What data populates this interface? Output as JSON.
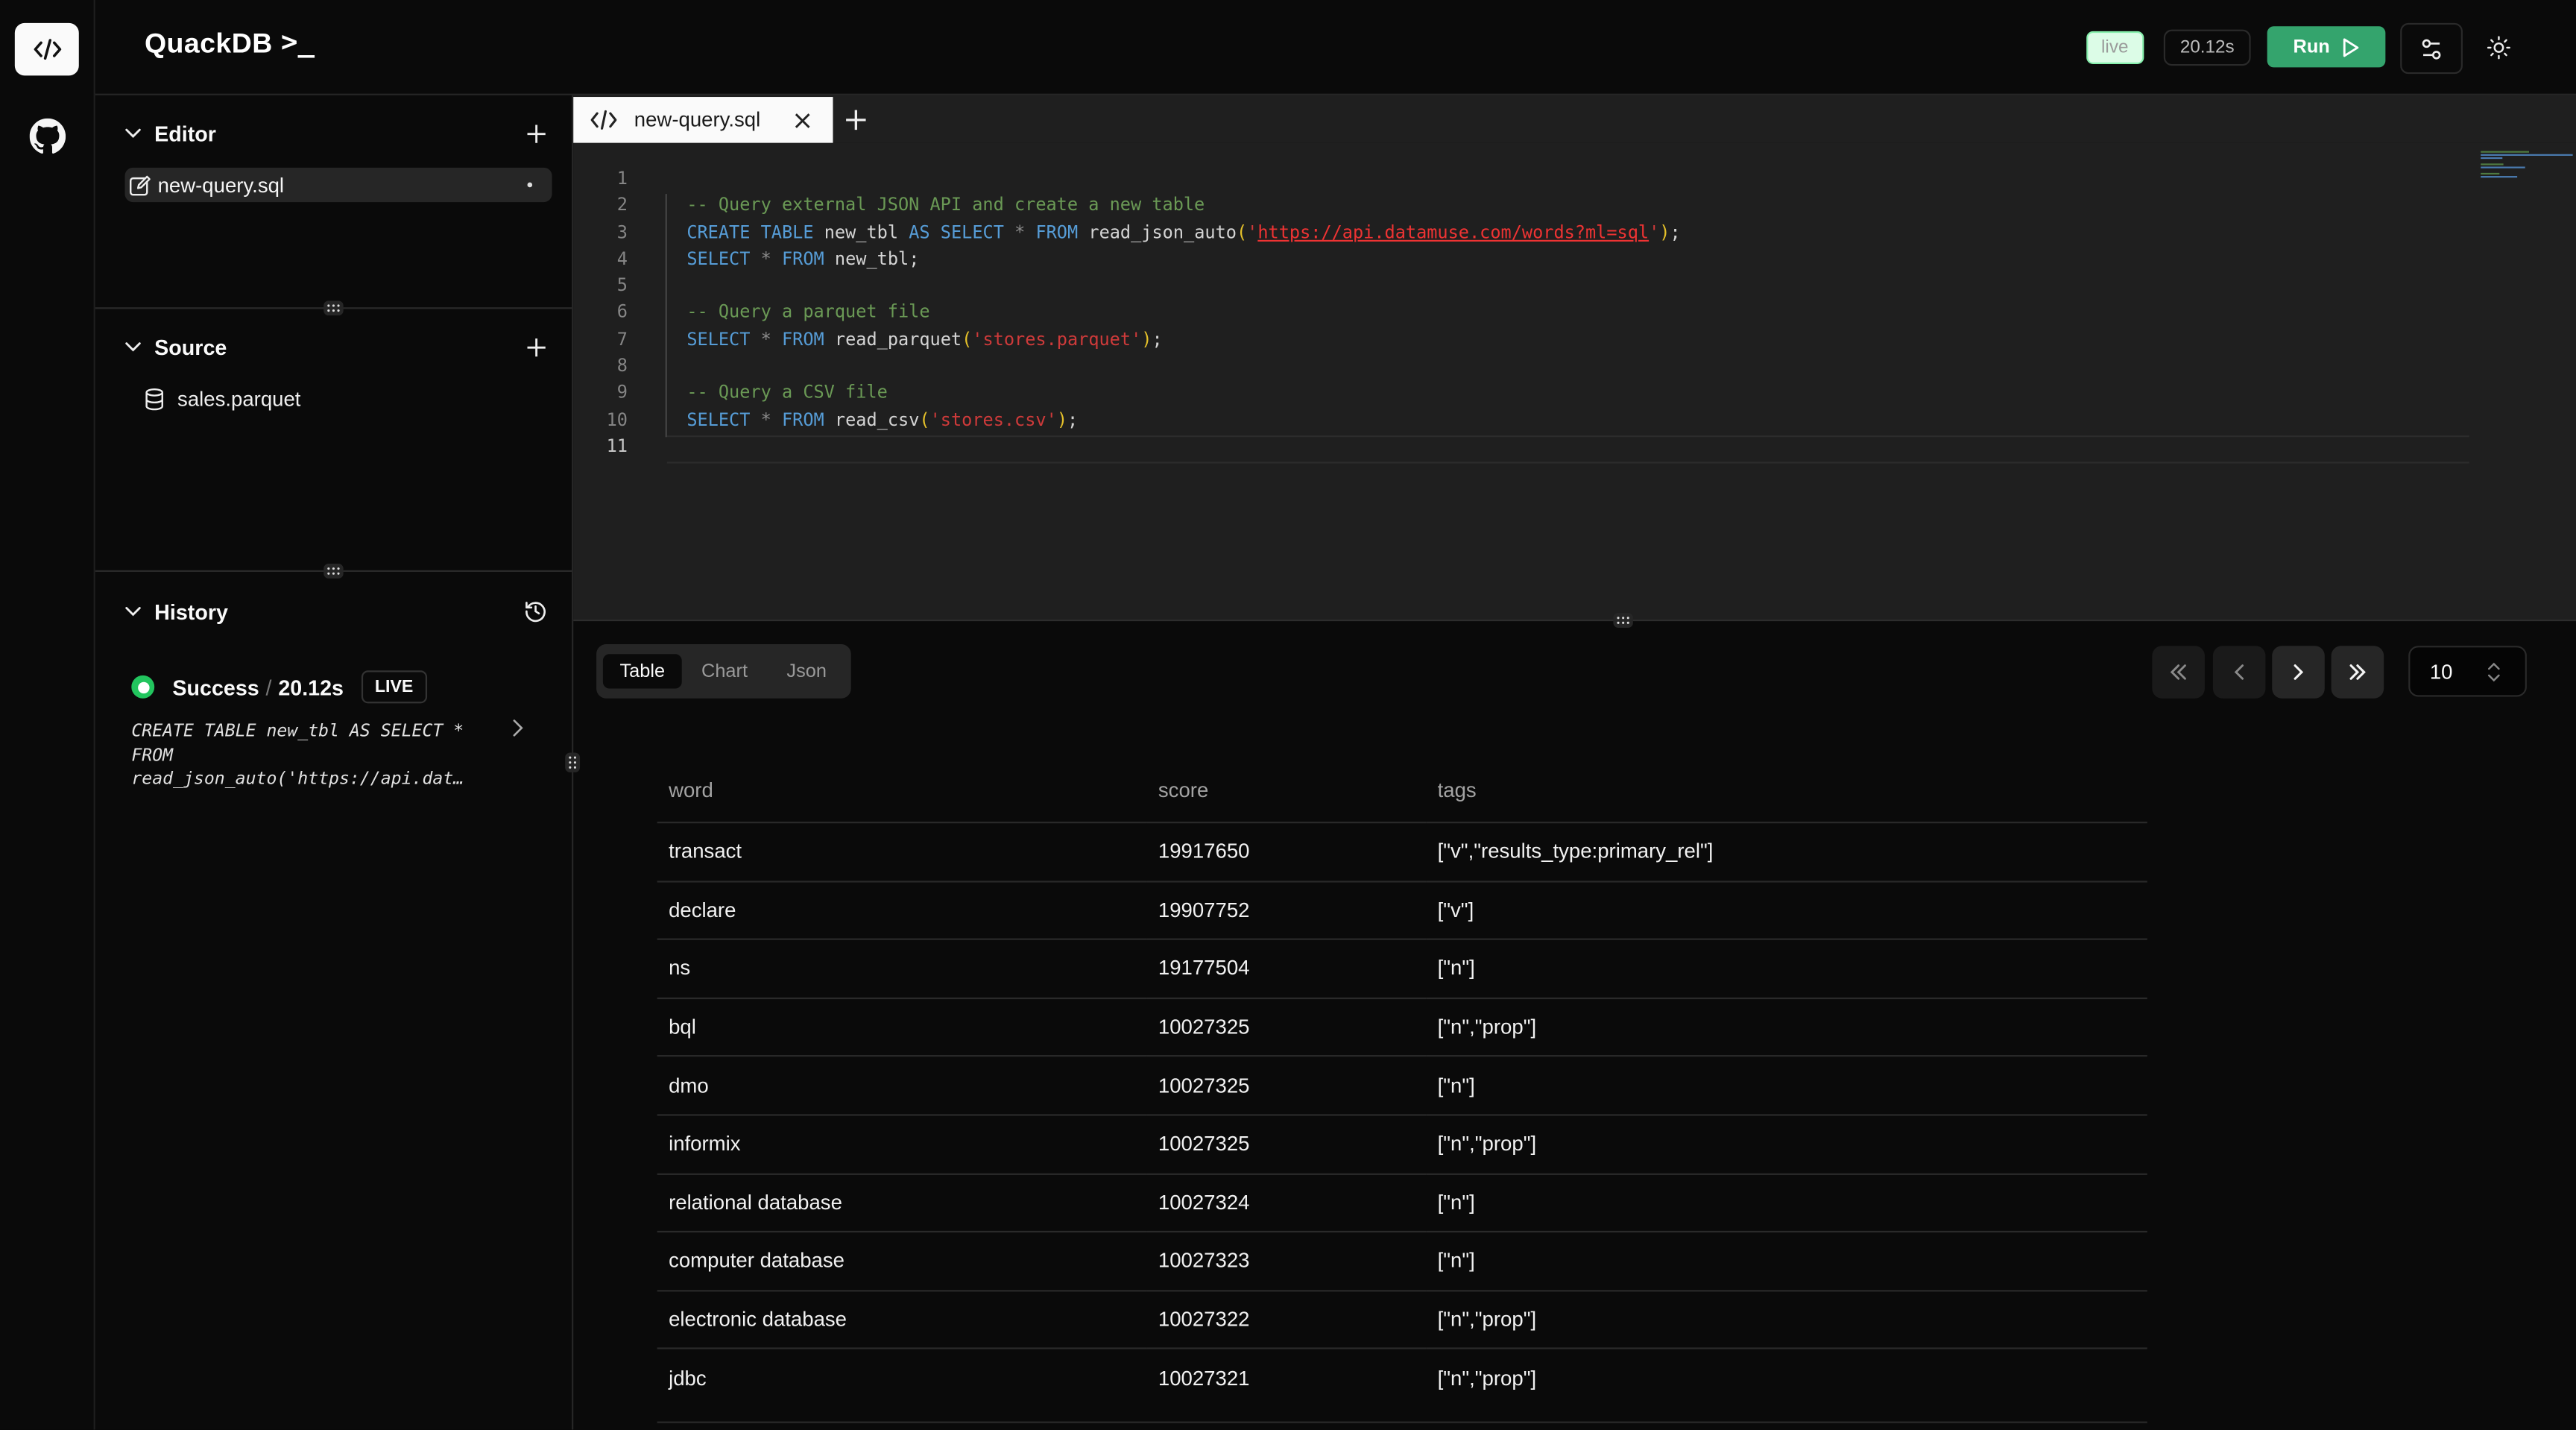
{
  "header": {
    "app_title": "QuackDB",
    "prompt_glyph": ">_",
    "live_badge": "live",
    "elapsed": "20.12s",
    "run_label": "Run"
  },
  "sidebar": {
    "editor": {
      "title": "Editor",
      "files": [
        {
          "name": "new-query.sql",
          "modified": true
        }
      ]
    },
    "source": {
      "title": "Source",
      "items": [
        {
          "name": "sales.parquet"
        }
      ]
    },
    "history": {
      "title": "History",
      "entries": [
        {
          "status": "Success",
          "separator": "/",
          "duration": "20.12s",
          "tag": "LIVE",
          "query_lines": [
            "CREATE TABLE new_tbl AS SELECT *",
            "FROM",
            "read_json_auto('https://api.dat…"
          ]
        }
      ]
    }
  },
  "editor": {
    "tabs": [
      {
        "label": "new-query.sql",
        "active": true
      }
    ],
    "lines": [
      "",
      "-- Query external JSON API and create a new table",
      "CREATE TABLE new_tbl AS SELECT * FROM read_json_auto('https://api.datamuse.com/words?ml=sql');",
      "SELECT * FROM new_tbl;",
      "",
      "-- Query a parquet file",
      "SELECT * FROM read_parquet('stores.parquet');",
      "",
      "-- Query a CSV file",
      "SELECT * FROM read_csv('stores.csv');",
      ""
    ],
    "current_line": 11
  },
  "results": {
    "view_tabs": [
      {
        "label": "Table",
        "active": true
      },
      {
        "label": "Chart",
        "active": false
      },
      {
        "label": "Json",
        "active": false
      }
    ],
    "page_size": "10",
    "columns": [
      "word",
      "score",
      "tags"
    ],
    "rows": [
      [
        "transact",
        "19917650",
        "[\"v\",\"results_type:primary_rel\"]"
      ],
      [
        "declare",
        "19907752",
        "[\"v\"]"
      ],
      [
        "ns",
        "19177504",
        "[\"n\"]"
      ],
      [
        "bql",
        "10027325",
        "[\"n\",\"prop\"]"
      ],
      [
        "dmo",
        "10027325",
        "[\"n\"]"
      ],
      [
        "informix",
        "10027325",
        "[\"n\",\"prop\"]"
      ],
      [
        "relational database",
        "10027324",
        "[\"n\"]"
      ],
      [
        "computer database",
        "10027323",
        "[\"n\"]"
      ],
      [
        "electronic database",
        "10027322",
        "[\"n\",\"prop\"]"
      ],
      [
        "jdbc",
        "10027321",
        "[\"n\",\"prop\"]"
      ]
    ]
  },
  "colors": {
    "accent": "#34a46d",
    "success": "#22c55e",
    "background": "#0a0a0a",
    "editor_bg": "#1f1f1f"
  }
}
